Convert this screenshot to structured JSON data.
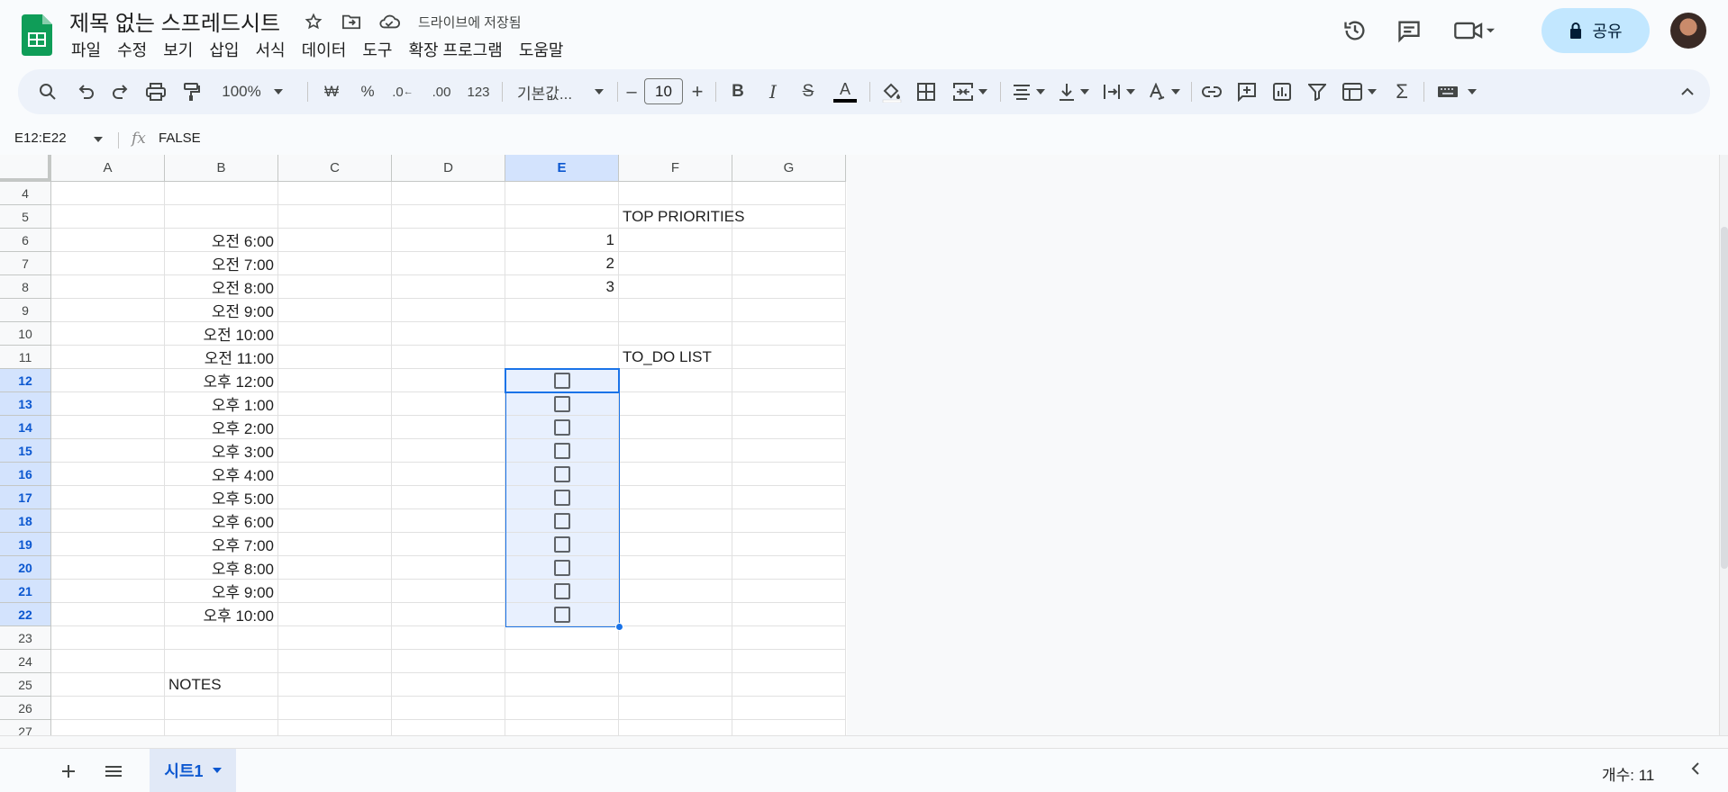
{
  "title": {
    "doc_name": "제목 없는 스프레드시트",
    "saved_status": "드라이브에 저장됨"
  },
  "menu": [
    "파일",
    "수정",
    "보기",
    "삽입",
    "서식",
    "데이터",
    "도구",
    "확장 프로그램",
    "도움말"
  ],
  "share": {
    "label": "공유"
  },
  "toolbar": {
    "zoom": "100%",
    "currency": "₩",
    "percent": "%",
    "decimal_decrease": ".0",
    "decimal_increase": ".00",
    "number_format": "123",
    "font_family": "기본값...",
    "font_size": "10",
    "minus": "–",
    "plus": "+",
    "bold": "B",
    "italic": "I",
    "strike": "S",
    "text_color": "A",
    "sum": "Σ"
  },
  "formula_bar": {
    "name_box": "E12:E22",
    "fx": "fx",
    "formula": "FALSE"
  },
  "columns": [
    "A",
    "B",
    "C",
    "D",
    "E",
    "F",
    "G"
  ],
  "selected_column": "E",
  "rows": [
    {
      "n": "4",
      "b": "",
      "e": "",
      "f": ""
    },
    {
      "n": "5",
      "b": "",
      "e": "",
      "f": "TOP PRIORITIES"
    },
    {
      "n": "6",
      "b": "오전 6:00",
      "e": "1",
      "f": ""
    },
    {
      "n": "7",
      "b": "오전 7:00",
      "e": "2",
      "f": ""
    },
    {
      "n": "8",
      "b": "오전 8:00",
      "e": "3",
      "f": ""
    },
    {
      "n": "9",
      "b": "오전 9:00",
      "e": "",
      "f": ""
    },
    {
      "n": "10",
      "b": "오전 10:00",
      "e": "",
      "f": ""
    },
    {
      "n": "11",
      "b": "오전 11:00",
      "e": "",
      "f": "TO_DO LIST"
    },
    {
      "n": "12",
      "b": "오후 12:00",
      "e": "checkbox",
      "f": ""
    },
    {
      "n": "13",
      "b": "오후 1:00",
      "e": "checkbox",
      "f": ""
    },
    {
      "n": "14",
      "b": "오후 2:00",
      "e": "checkbox",
      "f": ""
    },
    {
      "n": "15",
      "b": "오후 3:00",
      "e": "checkbox",
      "f": ""
    },
    {
      "n": "16",
      "b": "오후 4:00",
      "e": "checkbox",
      "f": ""
    },
    {
      "n": "17",
      "b": "오후 5:00",
      "e": "checkbox",
      "f": ""
    },
    {
      "n": "18",
      "b": "오후 6:00",
      "e": "checkbox",
      "f": ""
    },
    {
      "n": "19",
      "b": "오후 7:00",
      "e": "checkbox",
      "f": ""
    },
    {
      "n": "20",
      "b": "오후 8:00",
      "e": "checkbox",
      "f": ""
    },
    {
      "n": "21",
      "b": "오후 9:00",
      "e": "checkbox",
      "f": ""
    },
    {
      "n": "22",
      "b": "오후 10:00",
      "e": "checkbox",
      "f": ""
    },
    {
      "n": "23",
      "b": "",
      "e": "",
      "f": ""
    },
    {
      "n": "24",
      "b": "",
      "e": "",
      "f": ""
    },
    {
      "n": "25",
      "b": "NOTES",
      "e": "",
      "f": ""
    },
    {
      "n": "26",
      "b": "",
      "e": "",
      "f": ""
    },
    {
      "n": "27",
      "b": "",
      "e": "",
      "f": ""
    }
  ],
  "selected_rows": [
    "12",
    "13",
    "14",
    "15",
    "16",
    "17",
    "18",
    "19",
    "20",
    "21",
    "22"
  ],
  "sheet": {
    "tab_name": "시트1"
  },
  "status": {
    "count": "개수: 11"
  },
  "colors": {
    "accent": "#1a73e8",
    "selection_fill": "#e8f0fe",
    "header_selected": "#d3e3fd",
    "share_button": "#c2e7ff",
    "sheets_green": "#0f9d58"
  }
}
